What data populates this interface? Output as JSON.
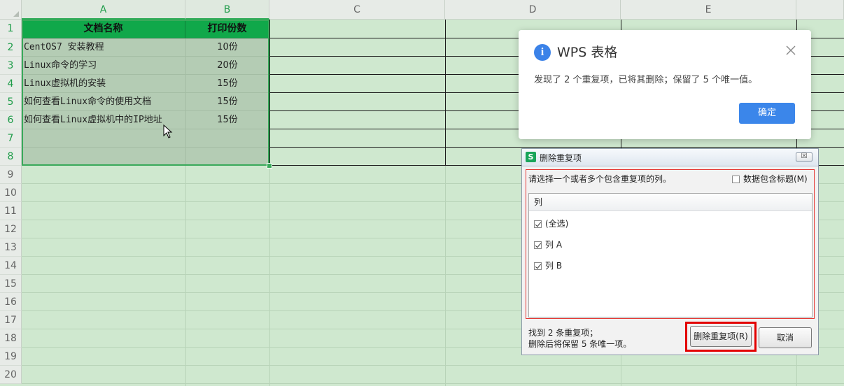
{
  "spreadsheet": {
    "columns": [
      "A",
      "B",
      "C",
      "D",
      "E"
    ],
    "rows": [
      "1",
      "2",
      "3",
      "4",
      "5",
      "6",
      "7",
      "8",
      "9",
      "10",
      "11",
      "12",
      "13",
      "14",
      "15",
      "16",
      "17",
      "18",
      "19",
      "20"
    ],
    "header_row": [
      "文档名称",
      "打印份数"
    ],
    "data_rows": [
      [
        "CentOS7 安装教程",
        "10份"
      ],
      [
        "Linux命令的学习",
        "20份"
      ],
      [
        "Linux虚拟机的安装",
        "15份"
      ],
      [
        "如何查看Linux命令的使用文档",
        "15份"
      ],
      [
        "如何查看Linux虚拟机中的IP地址",
        "15份"
      ]
    ],
    "colors": {
      "header_fill": "#10a84a",
      "sheet_bg": "#cfe8cf",
      "selection_border": "#39a95a"
    }
  },
  "popup": {
    "title": "WPS 表格",
    "message": "发现了 2 个重复项，已将其删除；保留了 5 个唯一值。",
    "ok_label": "确定",
    "icon": "info-icon",
    "close_icon": "close-icon"
  },
  "dialog": {
    "title": "删除重复项",
    "prompt": "请选择一个或者多个包含重复项的列。",
    "header_checkbox_label": "数据包含标题(M)",
    "header_checkbox_checked": false,
    "list_header": "列",
    "items": [
      {
        "label": "(全选)",
        "checked": true
      },
      {
        "label": "列 A",
        "checked": true
      },
      {
        "label": "列 B",
        "checked": true
      }
    ],
    "status_line1": "找到 2 条重复项；",
    "status_line2": "删除后将保留 5 条唯一项。",
    "remove_label": "删除重复项(R)",
    "cancel_label": "取消",
    "close_label": "☒"
  }
}
